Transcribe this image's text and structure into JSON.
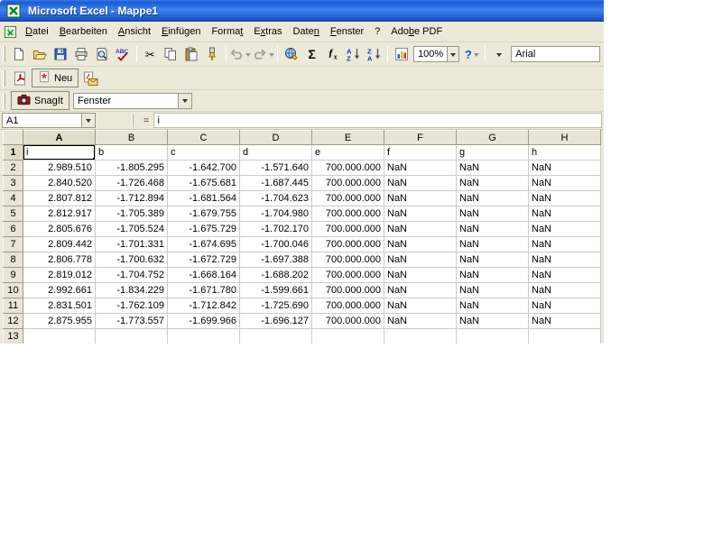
{
  "window": {
    "title": "Microsoft Excel - Mappe1"
  },
  "menu": {
    "items": [
      {
        "label": "Datei",
        "u": 0
      },
      {
        "label": "Bearbeiten",
        "u": 0
      },
      {
        "label": "Ansicht",
        "u": 0
      },
      {
        "label": "Einfügen",
        "u": 0
      },
      {
        "label": "Format",
        "u": 5
      },
      {
        "label": "Extras",
        "u": 1
      },
      {
        "label": "Daten",
        "u": 4
      },
      {
        "label": "Fenster",
        "u": 0
      },
      {
        "label": "?",
        "u": -1
      },
      {
        "label": "Adobe PDF",
        "u": 3
      }
    ]
  },
  "standard_toolbar": {
    "buttons": [
      {
        "name": "new-document-icon"
      },
      {
        "name": "open-icon"
      },
      {
        "name": "save-icon"
      },
      {
        "name": "print-icon"
      },
      {
        "name": "print-preview-icon"
      },
      {
        "name": "spelling-icon"
      },
      {
        "sep": true
      },
      {
        "name": "cut-icon"
      },
      {
        "name": "copy-icon"
      },
      {
        "name": "paste-icon"
      },
      {
        "name": "format-painter-icon"
      },
      {
        "sep": true
      },
      {
        "name": "undo-icon",
        "disabled": true,
        "caret": true
      },
      {
        "name": "redo-icon",
        "disabled": true,
        "caret": true
      },
      {
        "sep": true
      },
      {
        "name": "hyperlink-icon"
      },
      {
        "name": "autosum-icon"
      },
      {
        "name": "function-wizard-icon"
      },
      {
        "name": "sort-ascending-icon"
      },
      {
        "name": "sort-descending-icon"
      },
      {
        "sep": true
      },
      {
        "name": "chart-wizard-icon"
      }
    ],
    "zoom_value": "100%",
    "help_label": "?",
    "font_name": "Arial"
  },
  "pdf_toolbar": {
    "neu_label": "Neu"
  },
  "snagit_toolbar": {
    "label": "SnagIt",
    "mode_value": "Fenster"
  },
  "formula_bar": {
    "name_box": "A1",
    "edit_prefix": "=",
    "content": "i"
  },
  "sheet": {
    "columns": [
      "A",
      "B",
      "C",
      "D",
      "E",
      "F",
      "G",
      "H"
    ],
    "selected_cell": "A1",
    "rows": [
      {
        "n": 1,
        "cells": [
          "i",
          "b",
          "c",
          "d",
          "e",
          "f",
          "g",
          "h"
        ]
      },
      {
        "n": 2,
        "cells": [
          "2.989.510",
          "-1.805.295",
          "-1.642.700",
          "-1.571.640",
          "700.000.000",
          "NaN",
          "NaN",
          "NaN"
        ]
      },
      {
        "n": 3,
        "cells": [
          "2.840.520",
          "-1.726.468",
          "-1.675.681",
          "-1.687.445",
          "700.000.000",
          "NaN",
          "NaN",
          "NaN"
        ]
      },
      {
        "n": 4,
        "cells": [
          "2.807.812",
          "-1.712.894",
          "-1.681.564",
          "-1.704.623",
          "700.000.000",
          "NaN",
          "NaN",
          "NaN"
        ]
      },
      {
        "n": 5,
        "cells": [
          "2.812.917",
          "-1.705.389",
          "-1.679.755",
          "-1.704.980",
          "700.000.000",
          "NaN",
          "NaN",
          "NaN"
        ]
      },
      {
        "n": 6,
        "cells": [
          "2.805.676",
          "-1.705.524",
          "-1.675.729",
          "-1.702.170",
          "700.000.000",
          "NaN",
          "NaN",
          "NaN"
        ]
      },
      {
        "n": 7,
        "cells": [
          "2.809.442",
          "-1.701.331",
          "-1.674.695",
          "-1.700.046",
          "700.000.000",
          "NaN",
          "NaN",
          "NaN"
        ]
      },
      {
        "n": 8,
        "cells": [
          "2.806.778",
          "-1.700.632",
          "-1.672.729",
          "-1.697.388",
          "700.000.000",
          "NaN",
          "NaN",
          "NaN"
        ]
      },
      {
        "n": 9,
        "cells": [
          "2.819.012",
          "-1.704.752",
          "-1.668.164",
          "-1.688.202",
          "700.000.000",
          "NaN",
          "NaN",
          "NaN"
        ]
      },
      {
        "n": 10,
        "cells": [
          "2.992.661",
          "-1.834.229",
          "-1.671.780",
          "-1.599.661",
          "700.000.000",
          "NaN",
          "NaN",
          "NaN"
        ]
      },
      {
        "n": 11,
        "cells": [
          "2.831.501",
          "-1.762.109",
          "-1.712.842",
          "-1.725.690",
          "700.000.000",
          "NaN",
          "NaN",
          "NaN"
        ]
      },
      {
        "n": 12,
        "cells": [
          "2.875.955",
          "-1.773.557",
          "-1.699.966",
          "-1.696.127",
          "700.000.000",
          "NaN",
          "NaN",
          "NaN"
        ]
      },
      {
        "n": 13,
        "cells": [
          "",
          "",
          "",
          "",
          "",
          "",
          "",
          ""
        ]
      }
    ]
  }
}
